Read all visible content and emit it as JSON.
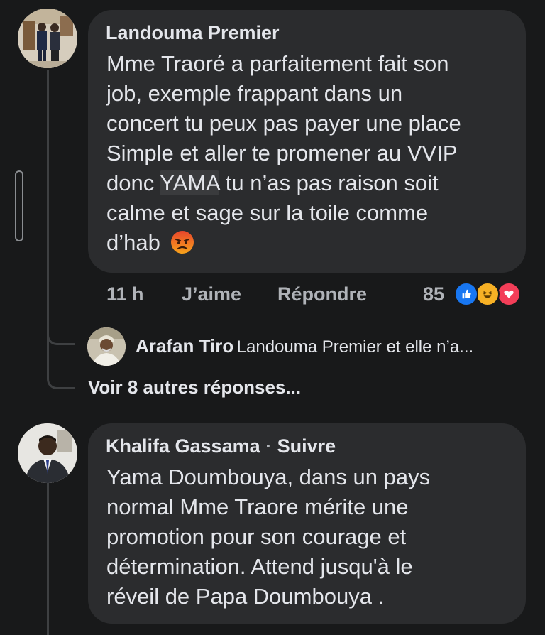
{
  "comments": [
    {
      "author": "Landouma Premier",
      "text_lines": [
        "Mme Traoré a parfaitement fait son",
        "job, exemple frappant dans un",
        "concert tu peux pas payer une place",
        "Simple et aller te promener au VVIP",
        "donc ",
        "YAMA",
        " tu n’as pas raison soit",
        "calme et sage sur la toile comme",
        "d’hab"
      ],
      "emoji_icon": "angry-face-emoji",
      "time": "11 h",
      "like_label": "J’aime",
      "reply_label": "Répondre",
      "reaction_count": "85",
      "reactions": [
        "like-icon",
        "haha-icon",
        "love-icon"
      ],
      "reply_preview": {
        "author": "Arafan Tiro",
        "snippet": "Landouma Premier et elle n’a..."
      },
      "more_replies": "Voir 8 autres réponses..."
    },
    {
      "author": "Khalifa Gassama",
      "separator": " · ",
      "follow_label": "Suivre",
      "text_lines": [
        "Yama Doumbouya,  dans un pays",
        "normal Mme Traore mérite une",
        "promotion pour son courage et",
        "détermination.  Attend jusqu'à le",
        "réveil de Papa Doumbouya ."
      ]
    }
  ],
  "colors": {
    "background": "#18191a",
    "bubble": "#2b2c2e",
    "text": "#e4e6eb",
    "meta": "#b0b3b8",
    "like_blue": "#1877f2",
    "love_red": "#f33e58",
    "haha_yellow": "#f7b125"
  }
}
